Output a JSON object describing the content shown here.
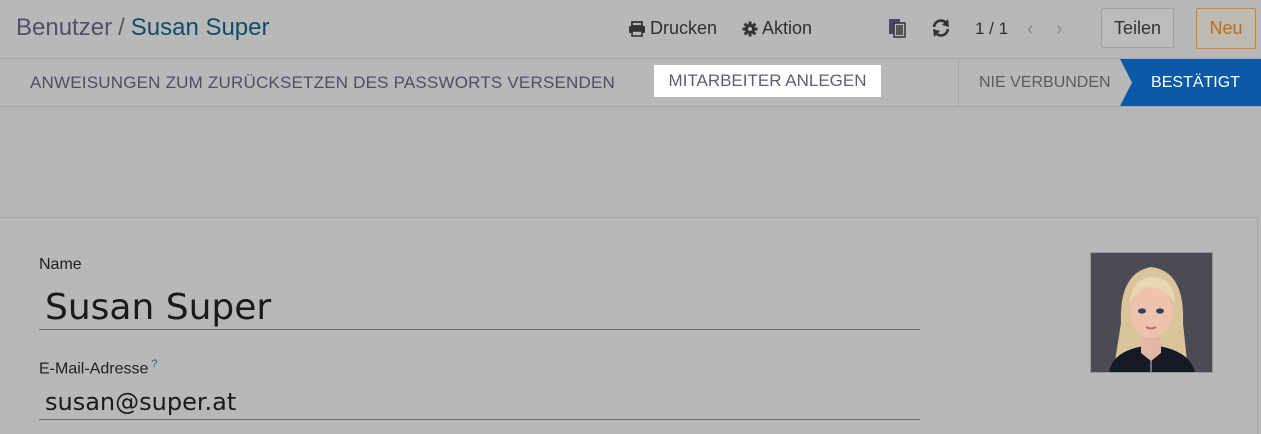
{
  "breadcrumb": {
    "parent": "Benutzer",
    "separator": "/",
    "current": "Susan Super"
  },
  "toolbar": {
    "print_label": "Drucken",
    "action_label": "Aktion",
    "pager": "1 / 1",
    "share_label": "Teilen",
    "new_label": "Neu"
  },
  "actions": {
    "reset_password": "ANWEISUNGEN ZUM ZURÜCKSETZEN DES PASSWORTS VERSENDEN",
    "create_employee": "MITARBEITER ANLEGEN"
  },
  "status": {
    "inactive": "NIE VERBUNDEN",
    "active": "BESTÄTIGT"
  },
  "form": {
    "name_label": "Name",
    "name_value": "Susan Super",
    "email_label": "E-Mail-Adresse",
    "email_help": "?",
    "email_value": "susan@super.at"
  },
  "icons": {
    "print": "printer-icon",
    "action": "gear-icon",
    "duplicate": "copy-icon",
    "reload": "refresh-icon",
    "prev": "chevron-left-icon",
    "next": "chevron-right-icon"
  },
  "colors": {
    "accent_blue": "#0b59a8",
    "new_button_orange": "#d7822b",
    "breadcrumb_current": "#0c4d6c"
  }
}
